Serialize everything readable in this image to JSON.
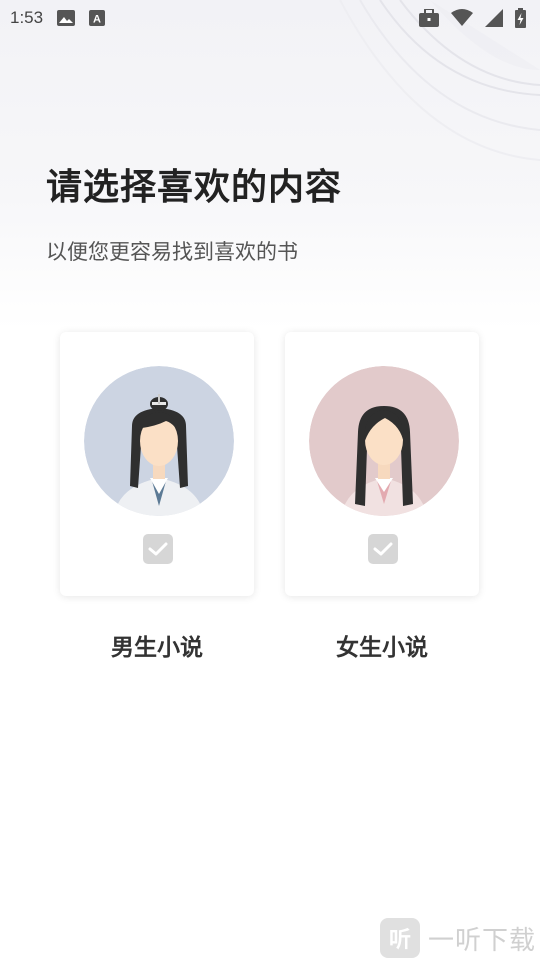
{
  "status_bar": {
    "time": "1:53",
    "left_icons": [
      "image-icon",
      "a-font-icon"
    ],
    "right_icons": [
      "briefcase-icon",
      "wifi-icon",
      "signal-icon",
      "battery-charging-icon"
    ]
  },
  "header": {
    "title": "请选择喜欢的内容",
    "subtitle": "以便您更容易找到喜欢的书"
  },
  "options": {
    "male": {
      "label": "男生小说",
      "avatar_bg": "#ccd4e2",
      "checked": false
    },
    "female": {
      "label": "女生小说",
      "avatar_bg": "#e2cacb",
      "checked": false
    }
  },
  "colors": {
    "checkbox_bg": "#d6d6d6",
    "title_color": "#222222"
  },
  "watermark": {
    "icon_glyph": "听",
    "text": "一听下载"
  }
}
